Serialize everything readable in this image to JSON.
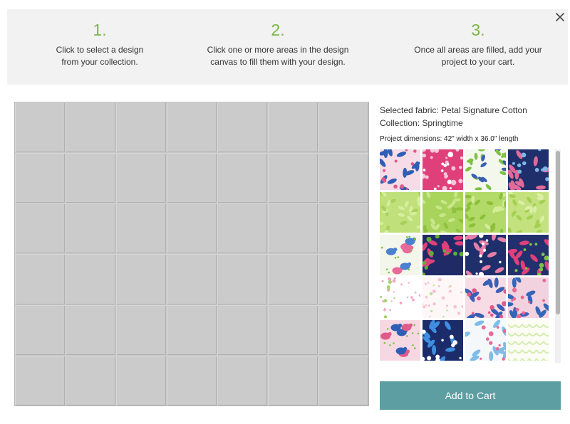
{
  "steps": [
    {
      "number": "1.",
      "text": "Click to select a design from your collection."
    },
    {
      "number": "2.",
      "text": "Click one or more areas in the design canvas to fill them with your design."
    },
    {
      "number": "3.",
      "text": "Once all areas are filled, add your project to your cart."
    }
  ],
  "close_icon": "close-icon",
  "canvas": {
    "columns": 7,
    "rows": 6,
    "cell_color": "#cbcbcb"
  },
  "info": {
    "selected_fabric": "Selected fabric: Petal Signature Cotton",
    "collection": "Collection: Springtime",
    "dimensions": "Project dimensions: 42\" width x 36.0\" length"
  },
  "swatches": [
    {
      "pattern": "floral-vine",
      "bg": "#f6dce6",
      "fg": "#2f5fb5",
      "accent": "#e05a8a"
    },
    {
      "pattern": "ditsy-floral",
      "bg": "#e0407a",
      "fg": "#f7c6d8",
      "accent": "#ffffff"
    },
    {
      "pattern": "botanical",
      "bg": "#f4f7ec",
      "fg": "#7ec242",
      "accent": "#3a5fb0"
    },
    {
      "pattern": "garden-navy",
      "bg": "#1e2f6b",
      "fg": "#e06a9a",
      "accent": "#7fb6e8"
    },
    {
      "pattern": "leaf-tonal",
      "bg": "#bfe07a",
      "fg": "#d6ee9e",
      "accent": "#a8d05c"
    },
    {
      "pattern": "leaf-tonal",
      "bg": "#a8d45c",
      "fg": "#c8e68a",
      "accent": "#8fc03e"
    },
    {
      "pattern": "leaf-tonal",
      "bg": "#b2da68",
      "fg": "#8cbf3a",
      "accent": "#d4ec98"
    },
    {
      "pattern": "leaf-tonal",
      "bg": "#c3e27e",
      "fg": "#a5cf52",
      "accent": "#dcefa8"
    },
    {
      "pattern": "birds",
      "bg": "#f3f6ea",
      "fg": "#4a80d0",
      "accent": "#e86a98"
    },
    {
      "pattern": "sprigs-navy",
      "bg": "#1f2a66",
      "fg": "#e0407a",
      "accent": "#5fae3a"
    },
    {
      "pattern": "floral-vine",
      "bg": "#1e2f6b",
      "fg": "#e77fa8",
      "accent": "#ffffff"
    },
    {
      "pattern": "tulip-navy",
      "bg": "#22306e",
      "fg": "#e0407a",
      "accent": "#7fc24a"
    },
    {
      "pattern": "dots",
      "bg": "#ffffff",
      "fg": "#f2a6bf",
      "accent": "#9fd36a"
    },
    {
      "pattern": "dots",
      "bg": "#fdf7f8",
      "fg": "#f5c4d2",
      "accent": "#b8e08a"
    },
    {
      "pattern": "floral-vine",
      "bg": "#f7dbe5",
      "fg": "#3a5fb5",
      "accent": "#e05a8a"
    },
    {
      "pattern": "floral-vine",
      "bg": "#f2d2de",
      "fg": "#3466b8",
      "accent": "#e66a95"
    },
    {
      "pattern": "birds",
      "bg": "#f6d8e3",
      "fg": "#2f5fb5",
      "accent": "#e05a8a"
    },
    {
      "pattern": "paisley-navy",
      "bg": "#1c2c6a",
      "fg": "#3f8ee0",
      "accent": "#ffffff"
    },
    {
      "pattern": "folk",
      "bg": "#f4f8fb",
      "fg": "#7fbce8",
      "accent": "#e86a98"
    },
    {
      "pattern": "scallop",
      "bg": "#fbfdf4",
      "fg": "#d7ebb0",
      "accent": "#c2df88"
    }
  ],
  "add_to_cart": {
    "label": "Add to Cart",
    "color": "#5c9ea2"
  }
}
